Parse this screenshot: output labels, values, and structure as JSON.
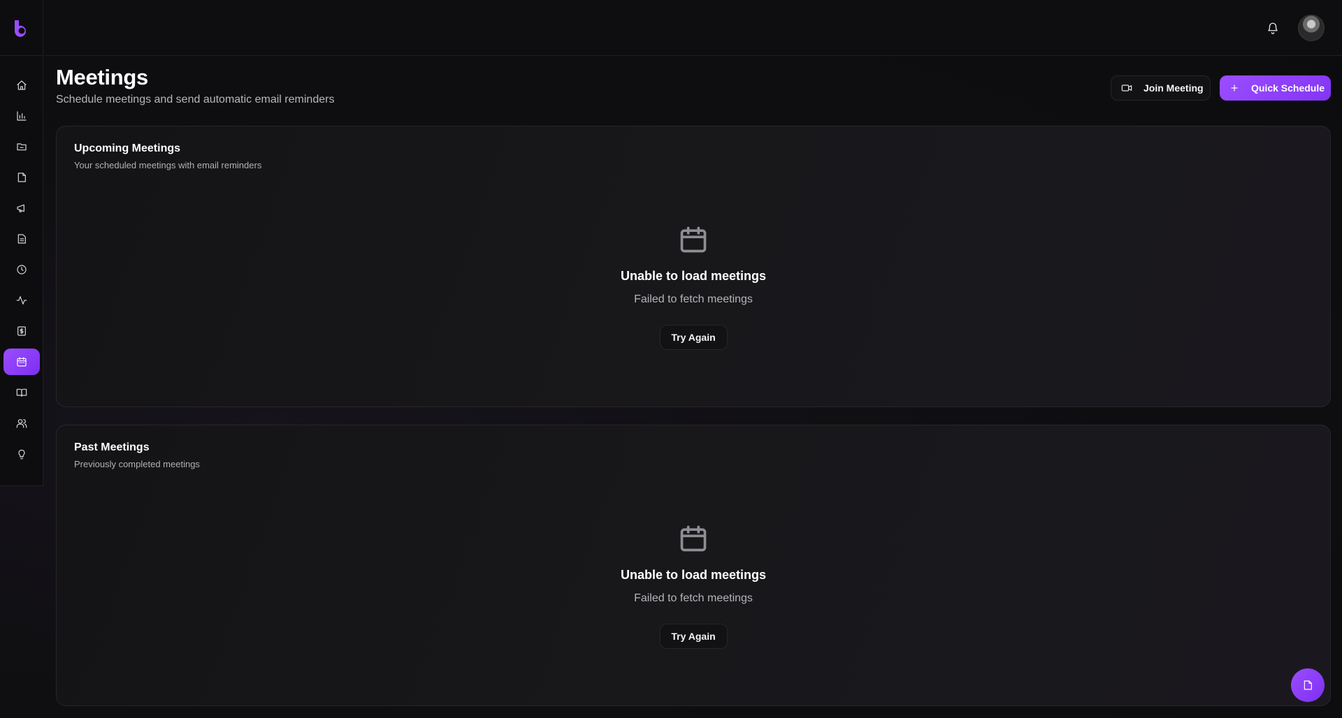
{
  "header": {
    "title": "Meetings",
    "subtitle": "Schedule meetings and send automatic email reminders",
    "join_label": "Join Meeting",
    "quick_label": "Quick Schedule"
  },
  "sidebar": {
    "items": [
      {
        "name": "home-icon",
        "active": false
      },
      {
        "name": "bar-chart-icon",
        "active": false
      },
      {
        "name": "folder-icon",
        "active": false
      },
      {
        "name": "file-icon",
        "active": false
      },
      {
        "name": "megaphone-icon",
        "active": false
      },
      {
        "name": "document-icon",
        "active": false
      },
      {
        "name": "clock-icon",
        "active": false
      },
      {
        "name": "activity-icon",
        "active": false
      },
      {
        "name": "dollar-icon",
        "active": false
      },
      {
        "name": "calendar-icon",
        "active": true
      },
      {
        "name": "book-icon",
        "active": false
      },
      {
        "name": "users-icon",
        "active": false
      },
      {
        "name": "lightbulb-icon",
        "active": false
      }
    ]
  },
  "upcoming": {
    "title": "Upcoming Meetings",
    "subtitle": "Your scheduled meetings with email reminders",
    "empty_title": "Unable to load meetings",
    "empty_sub": "Failed to fetch meetings",
    "retry_label": "Try Again"
  },
  "past": {
    "title": "Past Meetings",
    "subtitle": "Previously completed meetings",
    "empty_title": "Unable to load meetings",
    "empty_sub": "Failed to fetch meetings",
    "retry_label": "Try Again"
  },
  "colors": {
    "accent": "#9b4dff",
    "background": "#0c0c0e",
    "card": "#18181b"
  }
}
